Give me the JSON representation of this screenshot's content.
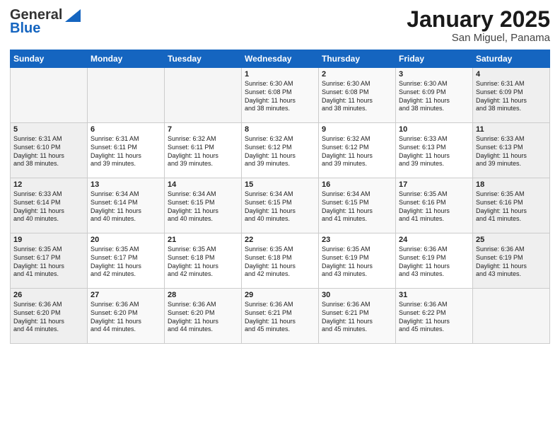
{
  "logo": {
    "general": "General",
    "blue": "Blue"
  },
  "title": "January 2025",
  "subtitle": "San Miguel, Panama",
  "days": [
    "Sunday",
    "Monday",
    "Tuesday",
    "Wednesday",
    "Thursday",
    "Friday",
    "Saturday"
  ],
  "weeks": [
    [
      {
        "day": "",
        "info": ""
      },
      {
        "day": "",
        "info": ""
      },
      {
        "day": "",
        "info": ""
      },
      {
        "day": "1",
        "info": "Sunrise: 6:30 AM\nSunset: 6:08 PM\nDaylight: 11 hours\nand 38 minutes."
      },
      {
        "day": "2",
        "info": "Sunrise: 6:30 AM\nSunset: 6:08 PM\nDaylight: 11 hours\nand 38 minutes."
      },
      {
        "day": "3",
        "info": "Sunrise: 6:30 AM\nSunset: 6:09 PM\nDaylight: 11 hours\nand 38 minutes."
      },
      {
        "day": "4",
        "info": "Sunrise: 6:31 AM\nSunset: 6:09 PM\nDaylight: 11 hours\nand 38 minutes."
      }
    ],
    [
      {
        "day": "5",
        "info": "Sunrise: 6:31 AM\nSunset: 6:10 PM\nDaylight: 11 hours\nand 38 minutes."
      },
      {
        "day": "6",
        "info": "Sunrise: 6:31 AM\nSunset: 6:11 PM\nDaylight: 11 hours\nand 39 minutes."
      },
      {
        "day": "7",
        "info": "Sunrise: 6:32 AM\nSunset: 6:11 PM\nDaylight: 11 hours\nand 39 minutes."
      },
      {
        "day": "8",
        "info": "Sunrise: 6:32 AM\nSunset: 6:12 PM\nDaylight: 11 hours\nand 39 minutes."
      },
      {
        "day": "9",
        "info": "Sunrise: 6:32 AM\nSunset: 6:12 PM\nDaylight: 11 hours\nand 39 minutes."
      },
      {
        "day": "10",
        "info": "Sunrise: 6:33 AM\nSunset: 6:13 PM\nDaylight: 11 hours\nand 39 minutes."
      },
      {
        "day": "11",
        "info": "Sunrise: 6:33 AM\nSunset: 6:13 PM\nDaylight: 11 hours\nand 39 minutes."
      }
    ],
    [
      {
        "day": "12",
        "info": "Sunrise: 6:33 AM\nSunset: 6:14 PM\nDaylight: 11 hours\nand 40 minutes."
      },
      {
        "day": "13",
        "info": "Sunrise: 6:34 AM\nSunset: 6:14 PM\nDaylight: 11 hours\nand 40 minutes."
      },
      {
        "day": "14",
        "info": "Sunrise: 6:34 AM\nSunset: 6:15 PM\nDaylight: 11 hours\nand 40 minutes."
      },
      {
        "day": "15",
        "info": "Sunrise: 6:34 AM\nSunset: 6:15 PM\nDaylight: 11 hours\nand 40 minutes."
      },
      {
        "day": "16",
        "info": "Sunrise: 6:34 AM\nSunset: 6:15 PM\nDaylight: 11 hours\nand 41 minutes."
      },
      {
        "day": "17",
        "info": "Sunrise: 6:35 AM\nSunset: 6:16 PM\nDaylight: 11 hours\nand 41 minutes."
      },
      {
        "day": "18",
        "info": "Sunrise: 6:35 AM\nSunset: 6:16 PM\nDaylight: 11 hours\nand 41 minutes."
      }
    ],
    [
      {
        "day": "19",
        "info": "Sunrise: 6:35 AM\nSunset: 6:17 PM\nDaylight: 11 hours\nand 41 minutes."
      },
      {
        "day": "20",
        "info": "Sunrise: 6:35 AM\nSunset: 6:17 PM\nDaylight: 11 hours\nand 42 minutes."
      },
      {
        "day": "21",
        "info": "Sunrise: 6:35 AM\nSunset: 6:18 PM\nDaylight: 11 hours\nand 42 minutes."
      },
      {
        "day": "22",
        "info": "Sunrise: 6:35 AM\nSunset: 6:18 PM\nDaylight: 11 hours\nand 42 minutes."
      },
      {
        "day": "23",
        "info": "Sunrise: 6:35 AM\nSunset: 6:19 PM\nDaylight: 11 hours\nand 43 minutes."
      },
      {
        "day": "24",
        "info": "Sunrise: 6:36 AM\nSunset: 6:19 PM\nDaylight: 11 hours\nand 43 minutes."
      },
      {
        "day": "25",
        "info": "Sunrise: 6:36 AM\nSunset: 6:19 PM\nDaylight: 11 hours\nand 43 minutes."
      }
    ],
    [
      {
        "day": "26",
        "info": "Sunrise: 6:36 AM\nSunset: 6:20 PM\nDaylight: 11 hours\nand 44 minutes."
      },
      {
        "day": "27",
        "info": "Sunrise: 6:36 AM\nSunset: 6:20 PM\nDaylight: 11 hours\nand 44 minutes."
      },
      {
        "day": "28",
        "info": "Sunrise: 6:36 AM\nSunset: 6:20 PM\nDaylight: 11 hours\nand 44 minutes."
      },
      {
        "day": "29",
        "info": "Sunrise: 6:36 AM\nSunset: 6:21 PM\nDaylight: 11 hours\nand 45 minutes."
      },
      {
        "day": "30",
        "info": "Sunrise: 6:36 AM\nSunset: 6:21 PM\nDaylight: 11 hours\nand 45 minutes."
      },
      {
        "day": "31",
        "info": "Sunrise: 6:36 AM\nSunset: 6:22 PM\nDaylight: 11 hours\nand 45 minutes."
      },
      {
        "day": "",
        "info": ""
      }
    ]
  ]
}
